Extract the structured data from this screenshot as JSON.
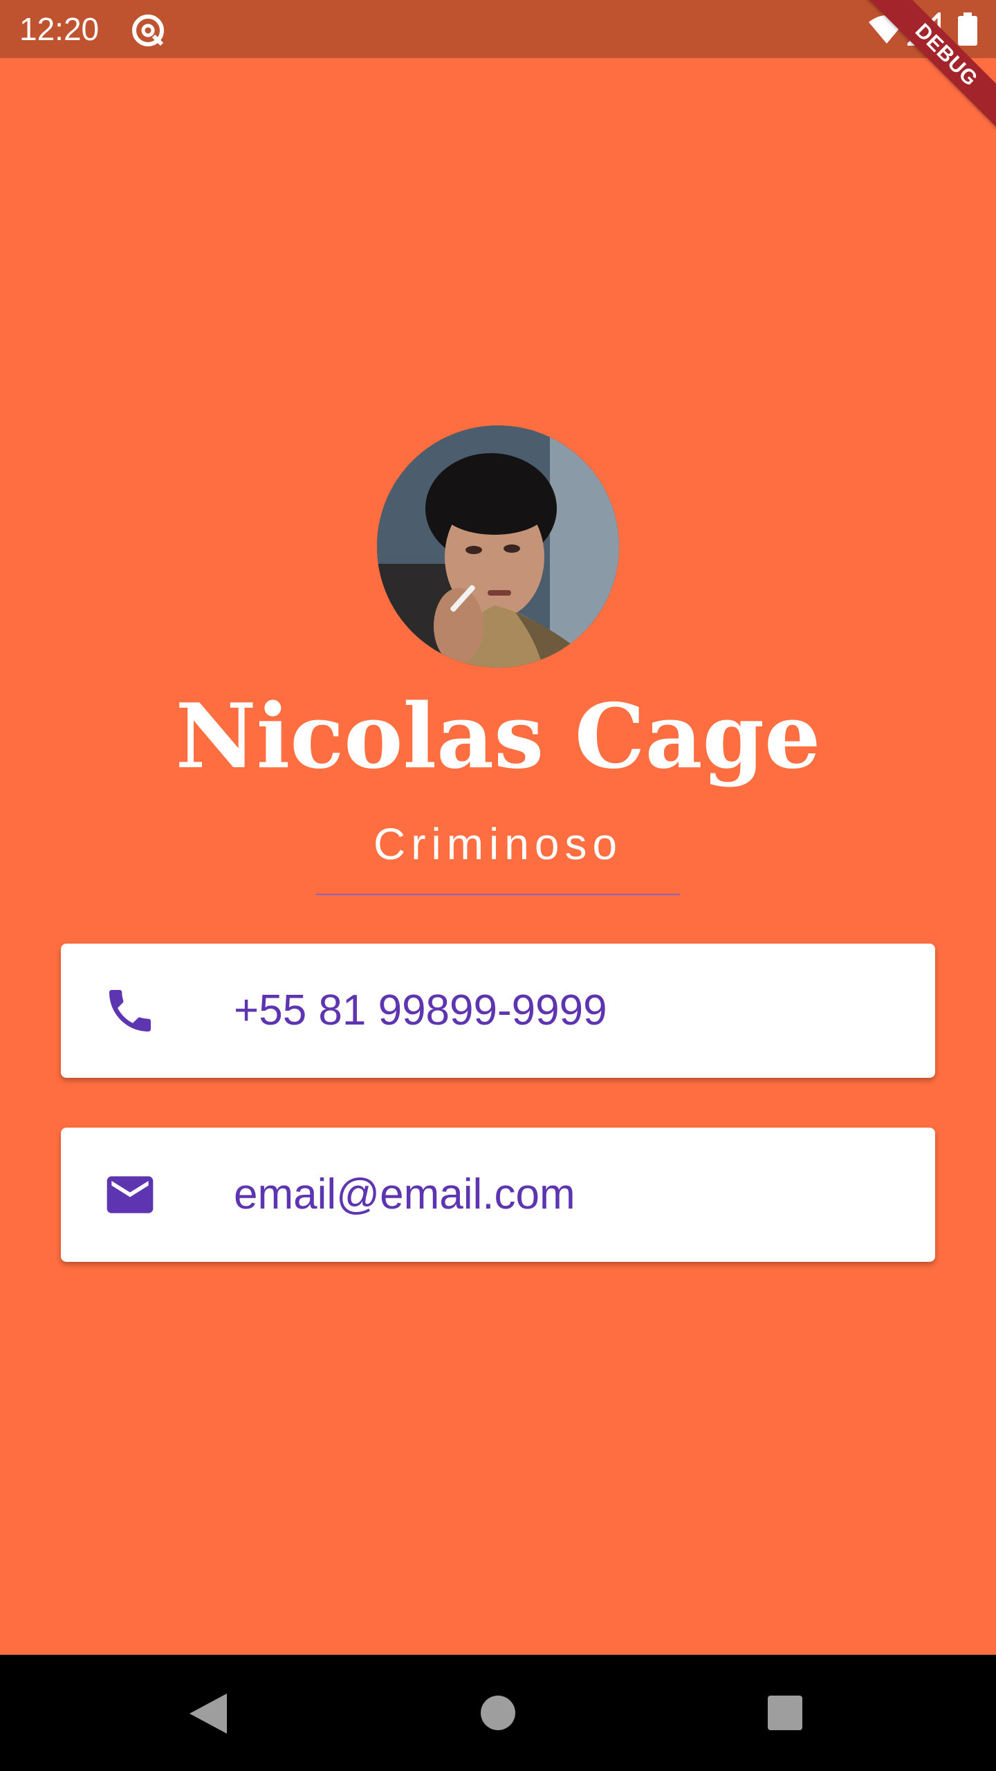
{
  "status_bar": {
    "time": "12:20",
    "background": "#bf5330",
    "icons": [
      "app-notification-icon",
      "wifi-icon",
      "cell-signal-icon",
      "battery-icon"
    ]
  },
  "debug_banner": {
    "label": "DEBUG",
    "color": "#a3242a"
  },
  "profile": {
    "avatar_icon": "profile-photo",
    "name": "Nicolas Cage",
    "title": "Criminoso",
    "background": "#ff6e40",
    "divider_color": "#8d63b8"
  },
  "contacts": [
    {
      "icon": "phone-icon",
      "text": "+55 81 99899-9999"
    },
    {
      "icon": "mail-icon",
      "text": "email@email.com"
    }
  ],
  "accent_color": "#5e35b1",
  "nav_bar": {
    "buttons": [
      "back-icon",
      "home-icon",
      "recents-icon"
    ]
  }
}
